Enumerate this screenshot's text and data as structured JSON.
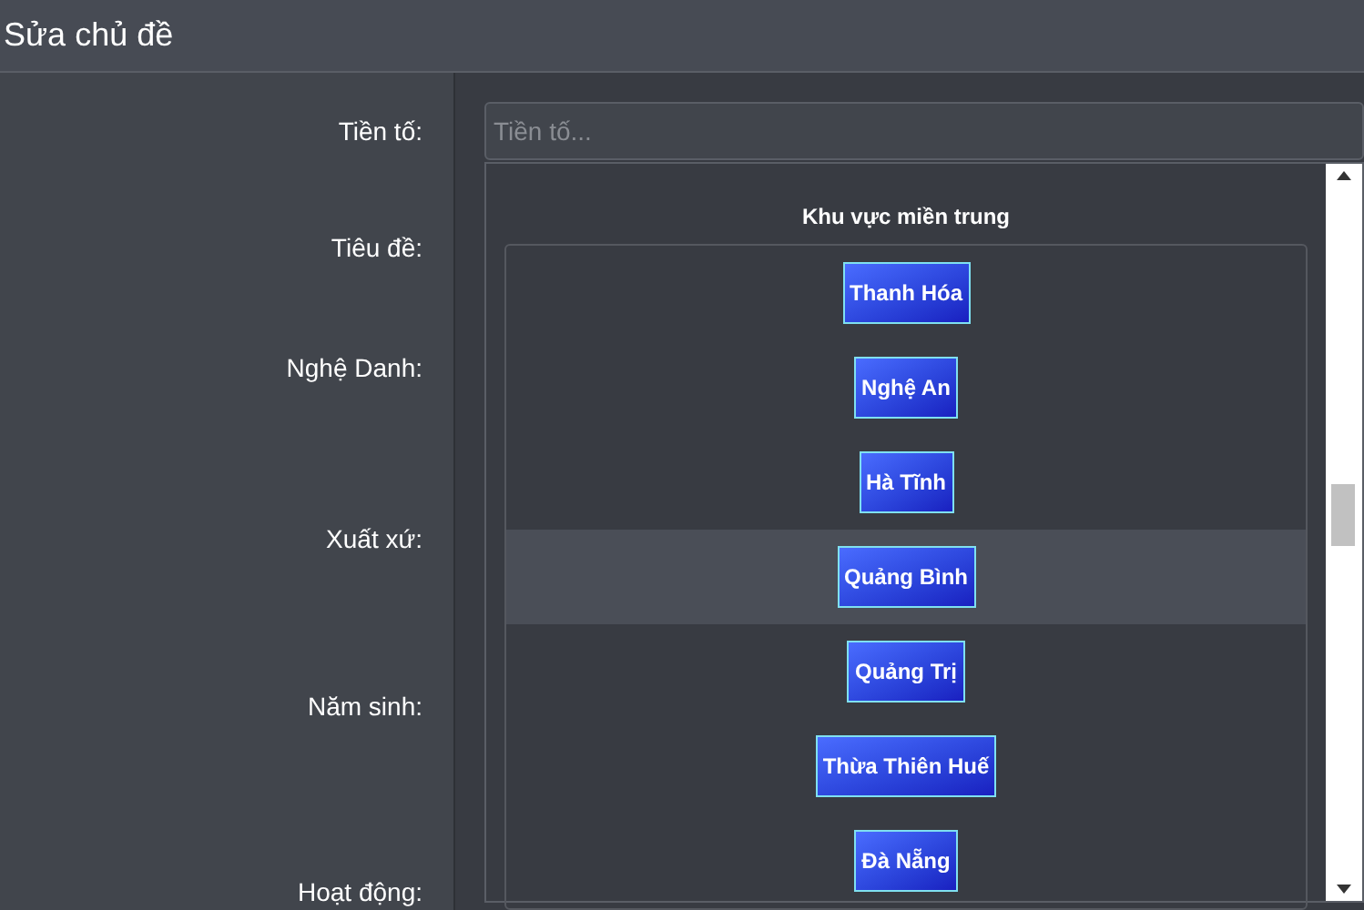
{
  "window": {
    "title": "Sửa chủ đề"
  },
  "form": {
    "labels": [
      "Tiền tố:",
      "Tiêu đề:",
      "Nghệ Danh:",
      "Xuất xứ:",
      "Năm sinh:",
      "Hoạt động:"
    ],
    "prefix_field": {
      "placeholder": "Tiền tố..."
    }
  },
  "dropdown": {
    "group_title": "Khu vực miền trung",
    "items": [
      {
        "label": "Thanh Hóa",
        "selected": false
      },
      {
        "label": "Nghệ An",
        "selected": false
      },
      {
        "label": "Hà Tĩnh",
        "selected": false
      },
      {
        "label": "Quảng Bình",
        "selected": true
      },
      {
        "label": "Quảng Trị",
        "selected": false
      },
      {
        "label": "Thừa Thiên Huế",
        "selected": false
      },
      {
        "label": "Đà Nẵng",
        "selected": false
      }
    ]
  }
}
